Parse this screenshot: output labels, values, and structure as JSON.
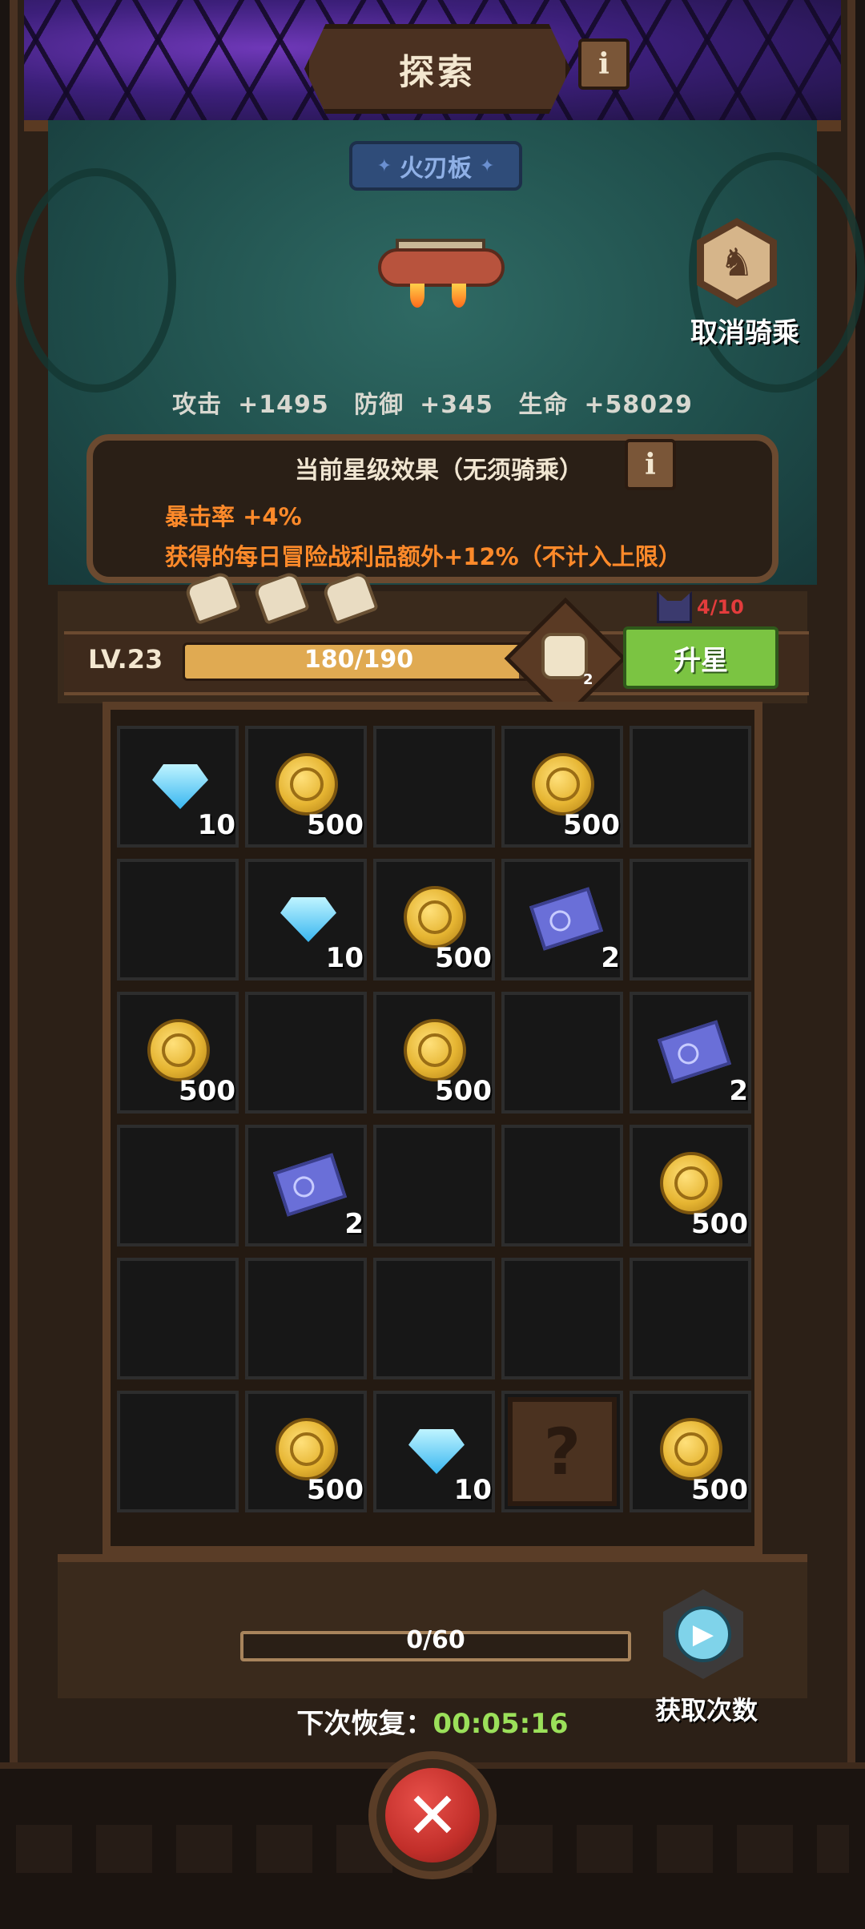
{
  "header": {
    "title": "探索",
    "info_icon": "info-icon"
  },
  "mount": {
    "name": "火刃板",
    "cancel_ride_label": "取消骑乘",
    "cancel_ride_icon": "horse-icon"
  },
  "stats": {
    "attack_label": "攻击",
    "attack_value": "+1495",
    "defense_label": "防御",
    "defense_value": "+345",
    "hp_label": "生命",
    "hp_value": "+58029"
  },
  "star_effect": {
    "title": "当前星级效果（无须骑乘）",
    "line1": "暴击率  +4%",
    "line2": "获得的每日冒险战利品额外+12%（不计入上限）",
    "accent_color": "#ff8a2a"
  },
  "upgrade": {
    "level": "LV.23",
    "progress_text": "180/190",
    "progress_fraction": 0.947,
    "food_count": "2",
    "star_up_label": "升星",
    "pet_count": "4/10"
  },
  "grid": {
    "cells": [
      {
        "item": "gem",
        "qty": "10"
      },
      {
        "item": "coin",
        "qty": "500"
      },
      {
        "item": "empty",
        "qty": ""
      },
      {
        "item": "coin",
        "qty": "500"
      },
      {
        "item": "empty",
        "qty": ""
      },
      {
        "item": "empty",
        "qty": ""
      },
      {
        "item": "gem",
        "qty": "10"
      },
      {
        "item": "coin",
        "qty": "500"
      },
      {
        "item": "ticket",
        "qty": "2"
      },
      {
        "item": "empty",
        "qty": ""
      },
      {
        "item": "coin",
        "qty": "500"
      },
      {
        "item": "empty",
        "qty": ""
      },
      {
        "item": "coin",
        "qty": "500"
      },
      {
        "item": "empty",
        "qty": ""
      },
      {
        "item": "ticket",
        "qty": "2"
      },
      {
        "item": "empty",
        "qty": ""
      },
      {
        "item": "ticket",
        "qty": "2"
      },
      {
        "item": "empty",
        "qty": ""
      },
      {
        "item": "empty",
        "qty": ""
      },
      {
        "item": "coin",
        "qty": "500"
      },
      {
        "item": "empty",
        "qty": ""
      },
      {
        "item": "empty",
        "qty": ""
      },
      {
        "item": "empty",
        "qty": ""
      },
      {
        "item": "empty",
        "qty": ""
      },
      {
        "item": "empty",
        "qty": ""
      },
      {
        "item": "empty",
        "qty": ""
      },
      {
        "item": "coin",
        "qty": "500"
      },
      {
        "item": "gem",
        "qty": "10"
      },
      {
        "item": "mystery",
        "qty": "?"
      },
      {
        "item": "coin",
        "qty": "500"
      }
    ]
  },
  "attempts": {
    "text": "0/60",
    "get_label": "获取次数",
    "recover_label": "下次恢复：",
    "recover_time": "00:05:16"
  },
  "footer": {
    "close_icon": "close-icon",
    "close_glyph": "✕"
  }
}
